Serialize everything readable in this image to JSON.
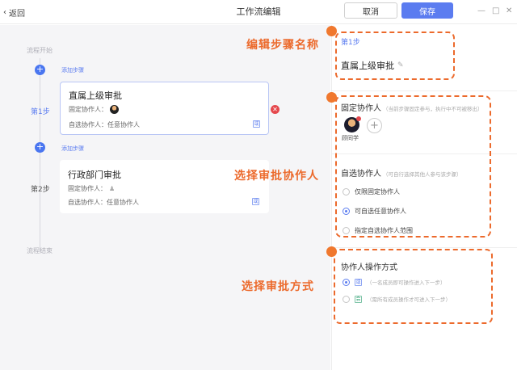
{
  "header": {
    "back_label": "返回",
    "title": "工作流编辑",
    "cancel_label": "取消",
    "save_label": "保存",
    "window_controls": [
      "—",
      "□",
      "✕"
    ]
  },
  "flow": {
    "start_label": "流程开始",
    "end_label": "流程结束",
    "add_step_label": "添加步骤",
    "steps": [
      {
        "number_label": "第1步",
        "title": "直属上级审批",
        "fixed_label": "固定协作人：",
        "optional_label": "自选协作人：任意协作人",
        "mode_tag": "或"
      },
      {
        "number_label": "第2步",
        "title": "行政部门审批",
        "fixed_label": "固定协作人：",
        "optional_label": "自选协作人：任意协作人",
        "mode_tag": "或"
      }
    ]
  },
  "panel": {
    "step_label": "第1步",
    "step_name": "直属上级审批",
    "fixed": {
      "heading": "固定协作人",
      "hint": "（当前步骤固定参与，执行中不可被移出）",
      "member_name": "顾同学"
    },
    "optional": {
      "heading": "自选协作人",
      "hint": "（可自行选择其他人参与该步骤）",
      "options": [
        "仅限固定协作人",
        "可自选任意协作人",
        "指定自选协作人范围"
      ],
      "selected_index": 1
    },
    "mode": {
      "heading": "协作人操作方式",
      "options": [
        {
          "tag": "或",
          "text": "（一名成员即可操作进入下一步）"
        },
        {
          "tag": "会",
          "text": "（需所有成员操作才可进入下一步）"
        }
      ],
      "selected_index": 0
    }
  },
  "annotations": {
    "callout_1": "编辑步骤名称",
    "callout_2": "选择审批协作人",
    "callout_3": "选择审批方式",
    "accent_color": "#ec6a2c"
  },
  "colors": {
    "primary": "#5b7cf0",
    "danger": "#e5484d",
    "canvas": "#f5f5f7"
  }
}
